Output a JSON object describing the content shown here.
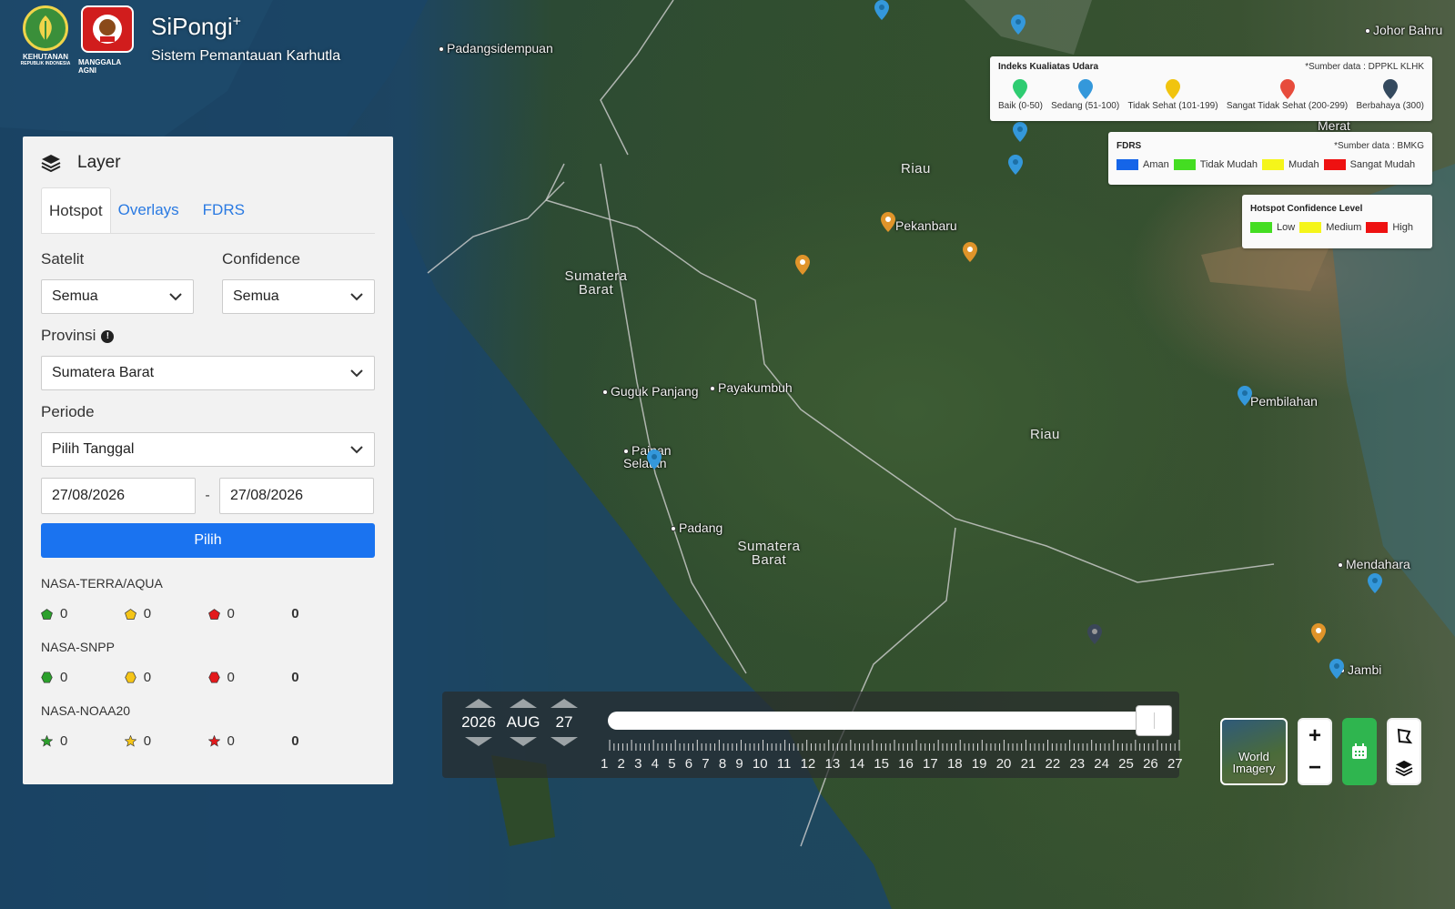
{
  "header": {
    "logo1_label": "KEHUTANAN",
    "logo1_sub": "REPUBLIK INDONESIA",
    "logo2_label": "MANGGALA AGNI",
    "title": "SiPongi",
    "title_sup": "+",
    "subtitle": "Sistem Pemantauan Karhutla"
  },
  "panel": {
    "title": "Layer",
    "tabs": [
      "Hotspot",
      "Overlays",
      "FDRS"
    ],
    "satelit_label": "Satelit",
    "satelit_value": "Semua",
    "confidence_label": "Confidence",
    "confidence_value": "Semua",
    "provinsi_label": "Provinsi",
    "provinsi_value": "Sumatera Barat",
    "periode_label": "Periode",
    "periode_value": "Pilih Tanggal",
    "date_from": "27/08/2026",
    "date_sep": "-",
    "date_to": "27/08/2026",
    "submit_label": "Pilih",
    "satellites": [
      {
        "name": "NASA-TERRA/AQUA",
        "low": "0",
        "medium": "0",
        "high": "0",
        "total": "0"
      },
      {
        "name": "NASA-SNPP",
        "low": "0",
        "medium": "0",
        "high": "0",
        "total": "0"
      },
      {
        "name": "NASA-NOAA20",
        "low": "0",
        "medium": "0",
        "high": "0",
        "total": "0"
      }
    ]
  },
  "legend_ispu": {
    "title": "Indeks Kualiatas Udara",
    "source": "*Sumber data : DPPKL KLHK",
    "items": [
      {
        "label": "Baik (0-50)",
        "color": "#2ecc71"
      },
      {
        "label": "Sedang (51-100)",
        "color": "#3498db"
      },
      {
        "label": "Tidak Sehat (101-199)",
        "color": "#f1c40f"
      },
      {
        "label": "Sangat Tidak Sehat (200-299)",
        "color": "#e74c3c"
      },
      {
        "label": "Berbahaya (300)",
        "color": "#34495e"
      }
    ]
  },
  "legend_fdrs": {
    "title": "FDRS",
    "source": "*Sumber data : BMKG",
    "items": [
      {
        "label": "Aman",
        "color": "#1565e8"
      },
      {
        "label": "Tidak Mudah",
        "color": "#44dd22"
      },
      {
        "label": "Mudah",
        "color": "#f5f51a"
      },
      {
        "label": "Sangat Mudah",
        "color": "#ee1111"
      }
    ]
  },
  "legend_confidence": {
    "title": "Hotspot Confidence Level",
    "items": [
      {
        "label": "Low",
        "color": "#44dd22"
      },
      {
        "label": "Medium",
        "color": "#f5f51a"
      },
      {
        "label": "High",
        "color": "#ee1111"
      }
    ]
  },
  "timeline": {
    "year": "2026",
    "month": "AUG",
    "day": "27",
    "days": [
      "1",
      "2",
      "3",
      "4",
      "5",
      "6",
      "7",
      "8",
      "9",
      "10",
      "11",
      "12",
      "13",
      "14",
      "15",
      "16",
      "17",
      "18",
      "19",
      "20",
      "21",
      "22",
      "23",
      "24",
      "25",
      "26",
      "27"
    ],
    "position_fraction": 1.0
  },
  "controls": {
    "basemap_label": "World Imagery",
    "zoom_in": "+",
    "zoom_out": "−"
  },
  "map": {
    "places": [
      "Padangsidempuan",
      "Johor Bahru",
      "Pekanbaru",
      "Guguk Panjang",
      "Payakumbuh",
      "Painan Selatan",
      "Padang",
      "Pembilahan",
      "Mendahara",
      "Jambi",
      "Merat"
    ],
    "regions": [
      "Riau",
      "Sumatera Barat",
      "Riau",
      "Sumatera Barat"
    ]
  }
}
